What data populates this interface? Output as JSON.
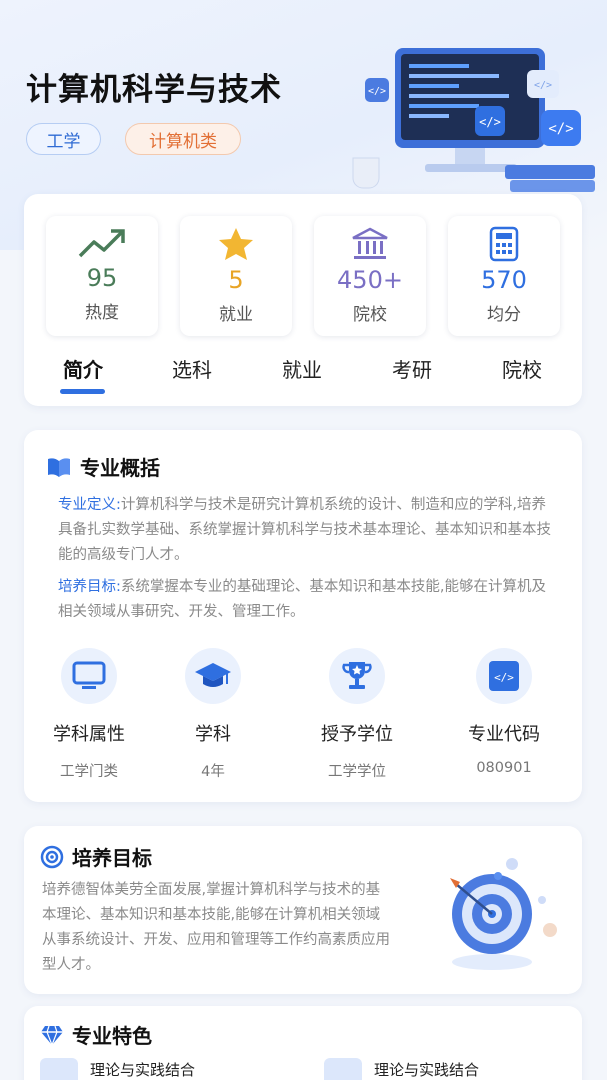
{
  "header": {
    "title": "计算机科学与技术",
    "tags": [
      "工学",
      "计算机类"
    ]
  },
  "stats": [
    {
      "value": "95",
      "label": "热度",
      "icon": "trending-up-icon",
      "color": "#4a7c59"
    },
    {
      "value": "5",
      "label": "就业",
      "icon": "star-icon",
      "color": "#e8a425"
    },
    {
      "value": "450+",
      "label": "院校",
      "icon": "bank-icon",
      "color": "#7a6fc4"
    },
    {
      "value": "570",
      "label": "均分",
      "icon": "calculator-icon",
      "color": "#2f6fe0"
    }
  ],
  "tabs": [
    {
      "label": "简介",
      "active": true
    },
    {
      "label": "选科",
      "active": false
    },
    {
      "label": "就业",
      "active": false
    },
    {
      "label": "考研",
      "active": false
    },
    {
      "label": "院校",
      "active": false
    }
  ],
  "overview": {
    "title": "专业概括",
    "definition_label": "专业定义:",
    "definition_text": "计算机科学与技术是研究计算机系统的设计、制造和应的学科,培养具备扎实数学基础、系统掌握计算机科学与技术基本理论、基本知识和基本技能的高级专门人才。",
    "goal_label": "培养目标:",
    "goal_text": "系统掌握本专业的基础理论、基本知识和基本技能,能够在计算机及相关领域从事研究、开发、管理工作。",
    "properties": [
      {
        "name": "学科属性",
        "value": "工学门类",
        "icon": "monitor-icon"
      },
      {
        "name": "学科",
        "value": "4年",
        "icon": "graduation-cap-icon"
      },
      {
        "name": "授予学位",
        "value": "工学学位",
        "icon": "trophy-icon"
      },
      {
        "name": "专业代码",
        "value": "080901",
        "icon": "code-icon"
      }
    ]
  },
  "training_goal": {
    "title": "培养目标",
    "text": "培养德智体美劳全面发展,掌握计算机科学与技术的基本理论、基本知识和基本技能,能够在计算机相关领域从事系统设计、开发、应用和管理等工作约高素质应用型人才。"
  },
  "features": {
    "title": "专业特色",
    "items": [
      "理论与实践结合",
      "理论与实践结合"
    ]
  },
  "colors": {
    "accent": "#2f6fe0",
    "tag_blue": "#2f6bd4",
    "tag_orange": "#e26f35"
  }
}
